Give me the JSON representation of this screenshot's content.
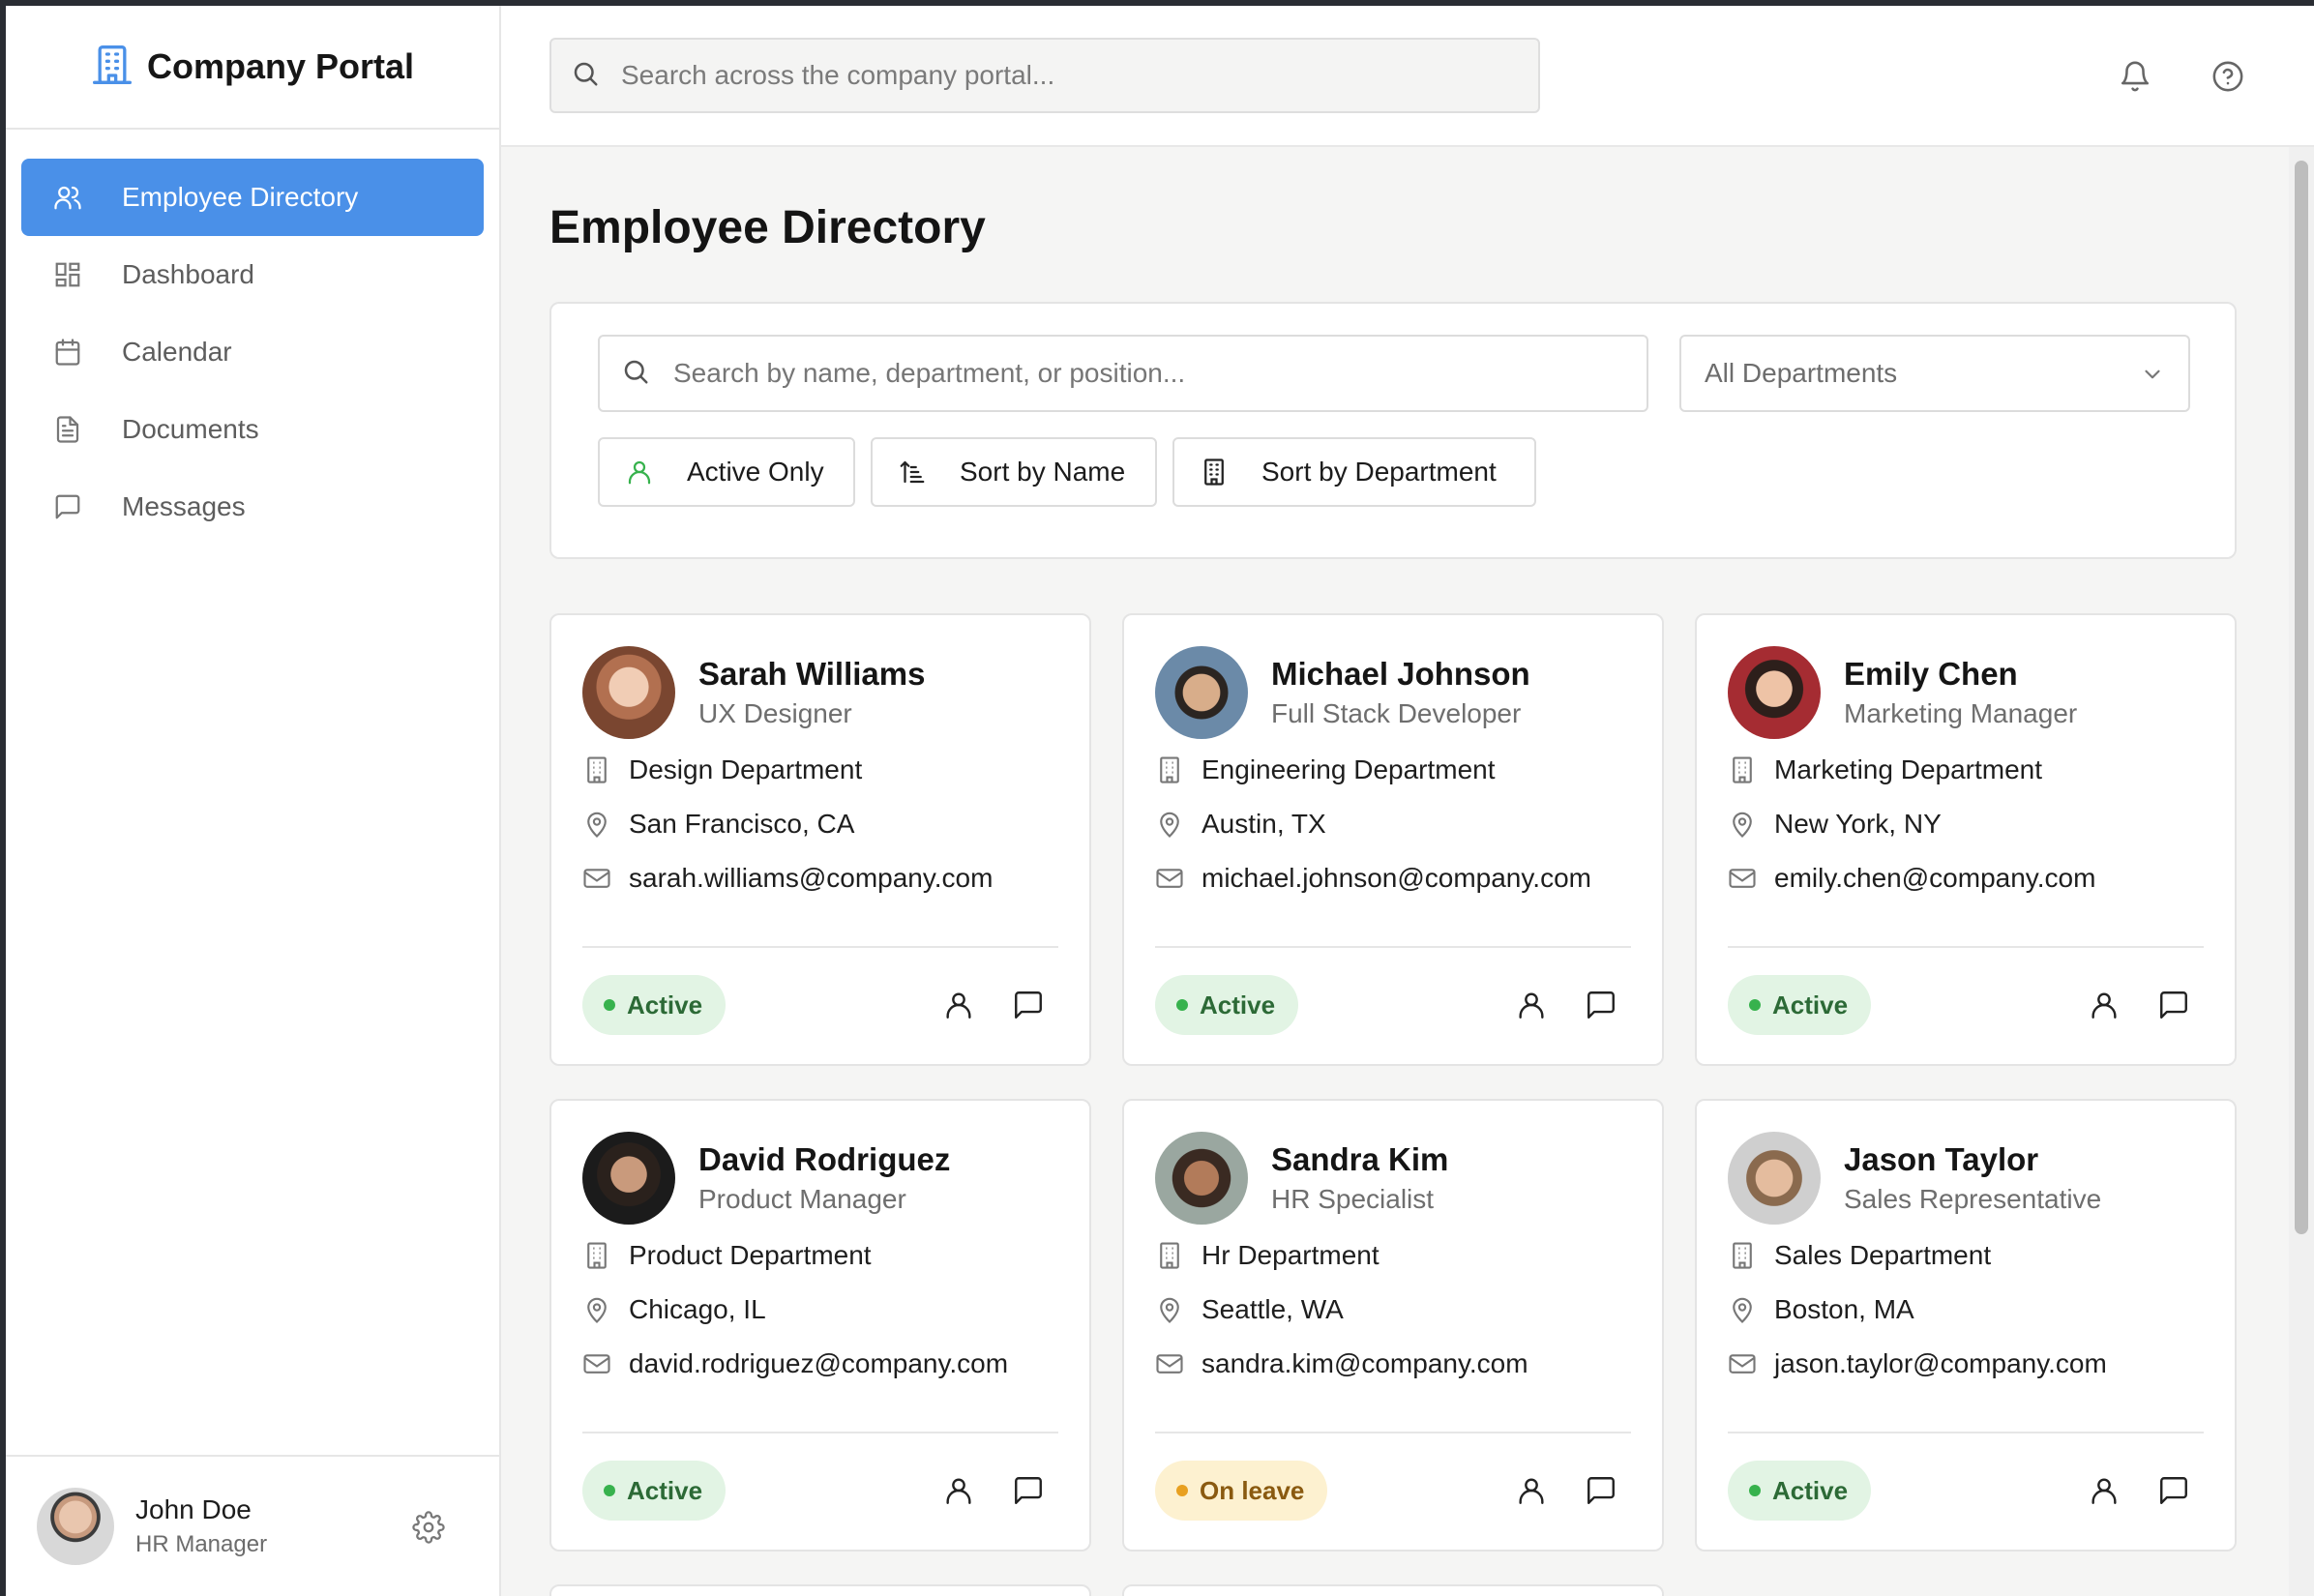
{
  "app": {
    "title": "Company Portal",
    "accent_color": "#4a90e8"
  },
  "sidebar": {
    "items": [
      {
        "label": "Employee Directory",
        "icon": "users-icon",
        "active": true
      },
      {
        "label": "Dashboard",
        "icon": "grid-icon",
        "active": false
      },
      {
        "label": "Calendar",
        "icon": "calendar-icon",
        "active": false
      },
      {
        "label": "Documents",
        "icon": "document-icon",
        "active": false
      },
      {
        "label": "Messages",
        "icon": "message-icon",
        "active": false
      }
    ],
    "user": {
      "name": "John Doe",
      "role": "HR Manager"
    }
  },
  "topbar": {
    "search_placeholder": "Search across the company portal..."
  },
  "main": {
    "title": "Employee Directory",
    "filters": {
      "search_placeholder": "Search by name, department, or position...",
      "department_select": "All Departments",
      "buttons": [
        "Active Only",
        "Sort by Name",
        "Sort by Department"
      ]
    },
    "employees": [
      {
        "name": "Sarah Williams",
        "position": "UX Designer",
        "department": "Design Department",
        "location": "San Francisco, CA",
        "email": "sarah.williams@company.com",
        "status": "Active"
      },
      {
        "name": "Michael Johnson",
        "position": "Full Stack Developer",
        "department": "Engineering Department",
        "location": "Austin, TX",
        "email": "michael.johnson@company.com",
        "status": "Active"
      },
      {
        "name": "Emily Chen",
        "position": "Marketing Manager",
        "department": "Marketing Department",
        "location": "New York, NY",
        "email": "emily.chen@company.com",
        "status": "Active"
      },
      {
        "name": "David Rodriguez",
        "position": "Product Manager",
        "department": "Product Department",
        "location": "Chicago, IL",
        "email": "david.rodriguez@company.com",
        "status": "Active"
      },
      {
        "name": "Sandra Kim",
        "position": "HR Specialist",
        "department": "Hr Department",
        "location": "Seattle, WA",
        "email": "sandra.kim@company.com",
        "status": "On leave"
      },
      {
        "name": "Jason Taylor",
        "position": "Sales Representative",
        "department": "Sales Department",
        "location": "Boston, MA",
        "email": "jason.taylor@company.com",
        "status": "Active"
      }
    ]
  }
}
